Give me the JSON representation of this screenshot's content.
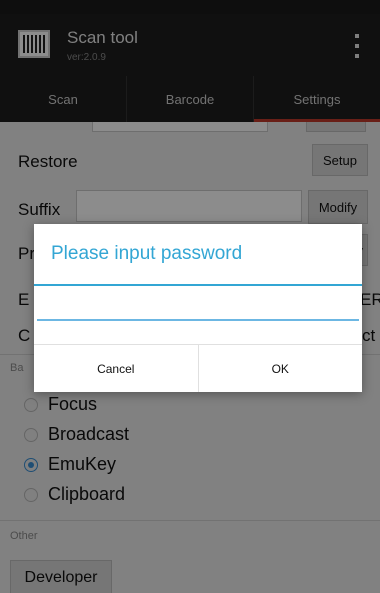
{
  "app": {
    "title": "Scan tool",
    "version": "ver:2.0.9",
    "icon": "barcode-icon",
    "menu_icon": "overflow-menu-icon"
  },
  "tabs": [
    {
      "label": "Scan"
    },
    {
      "label": "Barcode"
    },
    {
      "label": "Settings",
      "active": true
    }
  ],
  "settings": {
    "restore": {
      "label": "Restore",
      "button": "Setup"
    },
    "suffix": {
      "label": "Suffix",
      "value": "",
      "button": "Modify"
    },
    "partial": {
      "prefix_label": "Pr",
      "button_tail": "y"
    },
    "row_e": {
      "left": "E",
      "right": "ER"
    },
    "row_c": {
      "left": "C",
      "right": "ct"
    },
    "section_ba": "Ba",
    "output_modes": [
      {
        "label": "Focus",
        "checked": false
      },
      {
        "label": "Broadcast",
        "checked": false
      },
      {
        "label": "EmuKey",
        "checked": true
      },
      {
        "label": "Clipboard",
        "checked": false
      }
    ],
    "other_section": "Other",
    "developer_button": "Developer"
  },
  "dialog": {
    "title": "Please input password",
    "password_value": "",
    "cancel_label": "Cancel",
    "ok_label": "OK"
  },
  "colors": {
    "accent": "#33a6d4",
    "tab_indicator": "#c0392b",
    "radio_checked": "#3a8fd3"
  }
}
